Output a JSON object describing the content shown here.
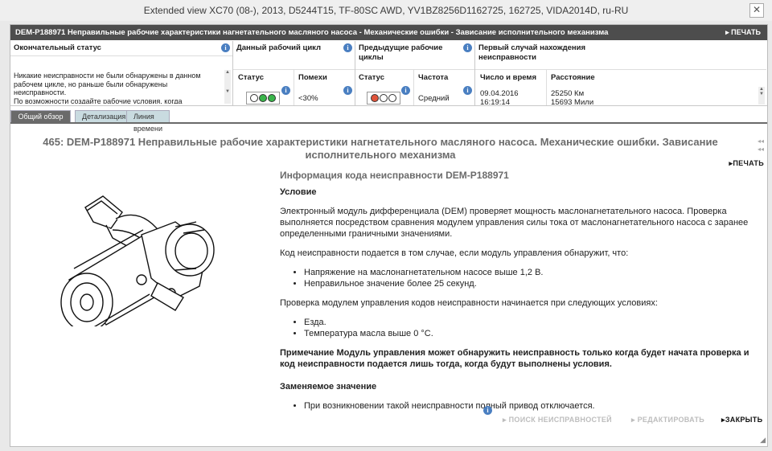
{
  "window": {
    "title": "Extended view   XC70 (08-), 2013, D5244T15, TF-80SC AWD, YV1BZ8256D1162725, 162725, VIDA2014D, ru-RU",
    "close": "✕"
  },
  "dtc": {
    "header": "DEM-P188971 Неправильные рабочие характеристики нагнетательного масляного насоса - Механические ошибки - Зависание исполнительного механизма",
    "print": "ПЕЧАТЬ"
  },
  "status_table": {
    "final_status": {
      "header": "Окончательный статус",
      "text": "Никакие неисправности не были обнаружены в данном рабочем цикле, но раньше были обнаружены неисправности.\nПо возможности создайте рабочие условия, когда"
    },
    "current_cycle": {
      "header": "Данный рабочий цикл",
      "col_status": "Статус",
      "col_noise": "Помехи",
      "noise_value": "<30%"
    },
    "previous_cycles": {
      "header": "Предыдущие рабочие циклы",
      "col_status": "Статус",
      "col_freq": "Частота",
      "freq_value": "Средний"
    },
    "first_occurrence": {
      "header": "Первый случай нахождения неисправности",
      "col_datetime": "Число и время",
      "col_distance": "Расстояние",
      "date": "09.04.2016",
      "time": "16:19:14",
      "km": "25250 Км",
      "miles": "15693 Мили"
    }
  },
  "tabs": [
    "Общий обзор",
    "Детализация",
    "Линия времени"
  ],
  "colors": {
    "green": "#39b54a",
    "red": "#e0533a"
  },
  "article": {
    "title_line1": "465: DEM-P188971 Неправильные рабочие характеристики нагнетательного масляного насоса. Механические ошибки. Зависание",
    "title_line2": "исполнительного механизма",
    "print": "ПЕЧАТЬ",
    "info_heading": "Информация кода неисправности DEM-P188971",
    "condition_heading": "Условие",
    "para1": "Электронный модуль дифференциала (DEM) проверяет мощность маслонагнетательного насоса. Проверка выполняется посредством сравнения модулем управления силы тока от маслонагнетательного насоса с заранее определенными граничными значениями.",
    "para2": "Код неисправности подается в том случае, если модуль управления обнаружит, что:",
    "list1": [
      "Напряжение на маслонагнетательном насосе выше 1,2 В.",
      "Неправильное значение более 25 секунд."
    ],
    "para3": "Проверка модулем управления кодов неисправности начинается при следующих условиях:",
    "list2": [
      "Езда.",
      "Температура масла выше 0 °C."
    ],
    "note": "Примечание Модуль управления может обнаружить неисправность только когда будет начата проверка и код неисправности подается лишь тогда, когда будут выполнены условия.",
    "replace_heading": "Заменяемое значение",
    "list3": [
      "При возникновении такой неисправности полный привод отключается."
    ]
  },
  "footer": {
    "search": "ПОИСК НЕИСПРАВНОСТЕЙ",
    "edit": "РЕДАКТИРОВАТЬ",
    "close": "ЗАКРЫТЬ"
  }
}
